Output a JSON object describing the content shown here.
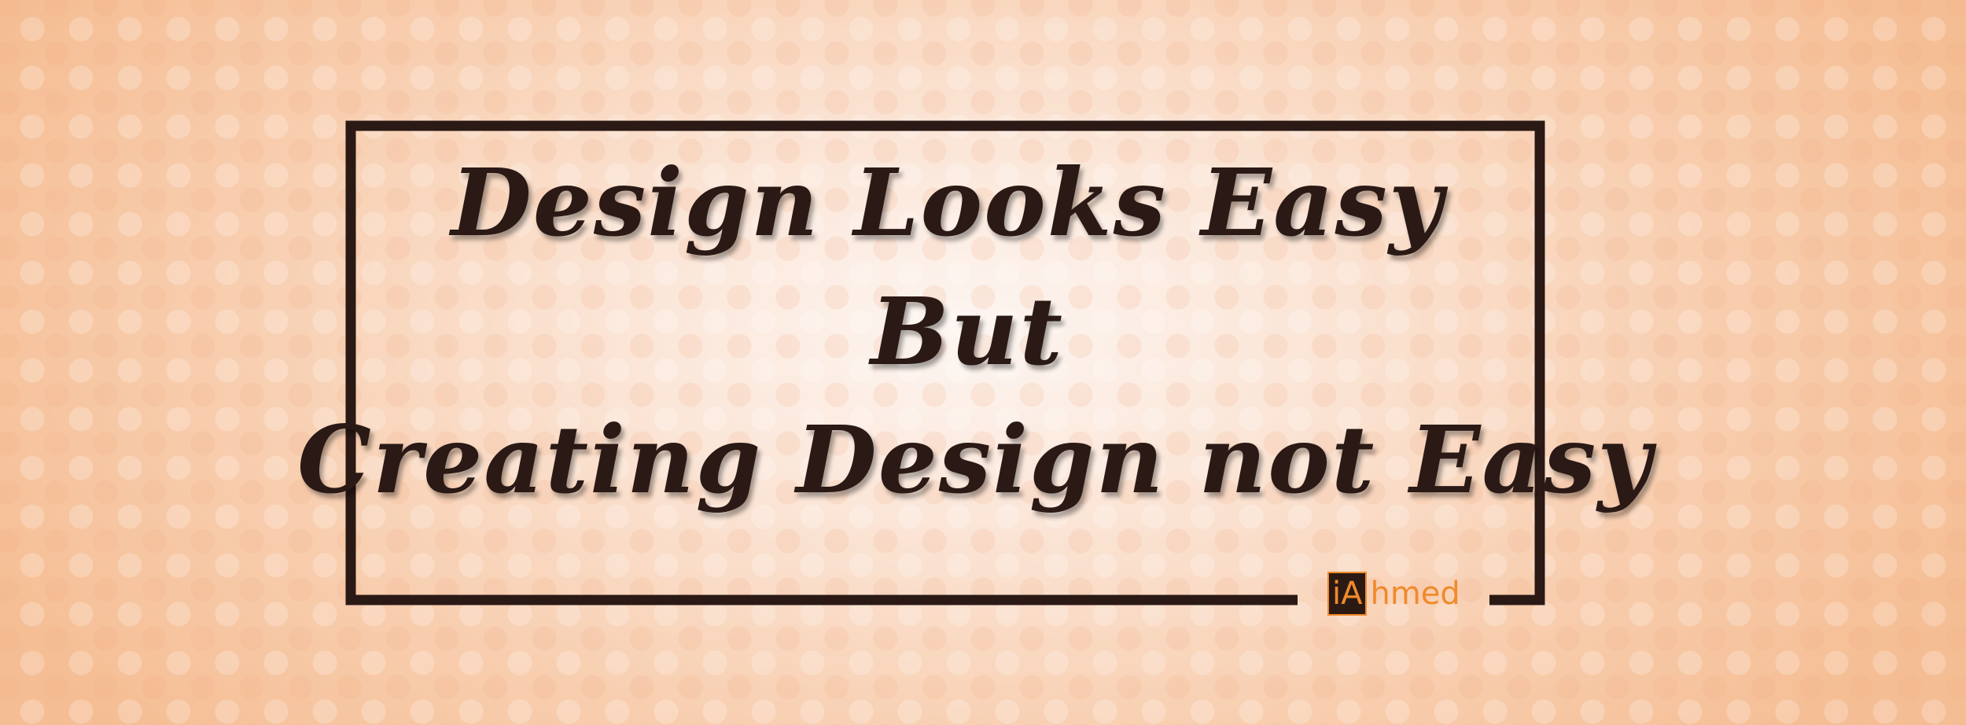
{
  "quote": {
    "line1": "Design Looks Easy",
    "line2": "But",
    "line3": "Creating Design not Easy"
  },
  "brand": {
    "mark": "iA",
    "rest": "hmed"
  },
  "colors": {
    "text": "#2a1915",
    "frame": "#2a1915",
    "brand_accent": "#f08a2c",
    "background_center": "#fdf6f2",
    "background_edge": "#f5bd93"
  }
}
